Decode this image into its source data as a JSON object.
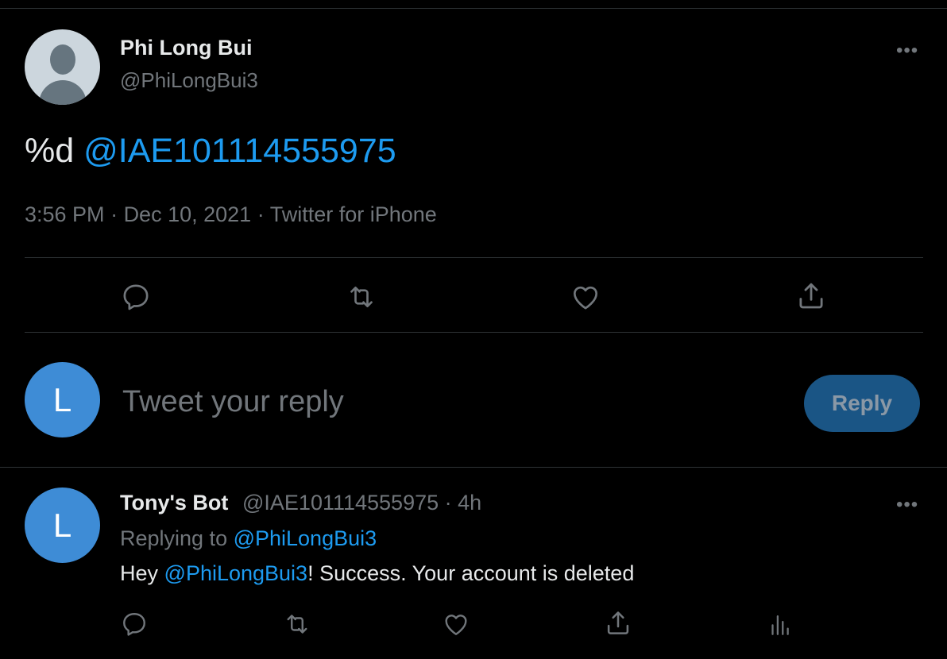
{
  "tweet": {
    "author_name": "Phi Long Bui",
    "author_handle": "@PhiLongBui3",
    "more_icon": "more-horizontal-icon",
    "text_prefix": "%d ",
    "text_mention": "@IAE101114555975",
    "time": "3:56 PM",
    "date": "Dec 10, 2021",
    "source": "Twitter for iPhone",
    "separator": " · ",
    "actions": [
      "reply-icon",
      "retweet-icon",
      "like-icon",
      "share-icon"
    ]
  },
  "compose": {
    "avatar_letter": "L",
    "placeholder": "Tweet your reply",
    "button_label": "Reply"
  },
  "reply": {
    "avatar_letter": "L",
    "author_name": "Tony's Bot",
    "author_handle": "@IAE101114555975",
    "time_ago": "4h",
    "replying_label": "Replying to ",
    "replying_handle": "@PhiLongBui3",
    "text_before": "Hey ",
    "text_mention": "@PhiLongBui3",
    "text_after": "! Success. Your account is deleted",
    "actions": [
      "reply-icon",
      "retweet-icon",
      "like-icon",
      "share-icon",
      "analytics-icon"
    ]
  },
  "colors": {
    "background": "#000000",
    "text": "#e7e9ea",
    "secondary": "#71767b",
    "link": "#1d9bf0",
    "avatar": "#3e8cd6",
    "button": "#1a5585",
    "divider": "#2f3336"
  }
}
